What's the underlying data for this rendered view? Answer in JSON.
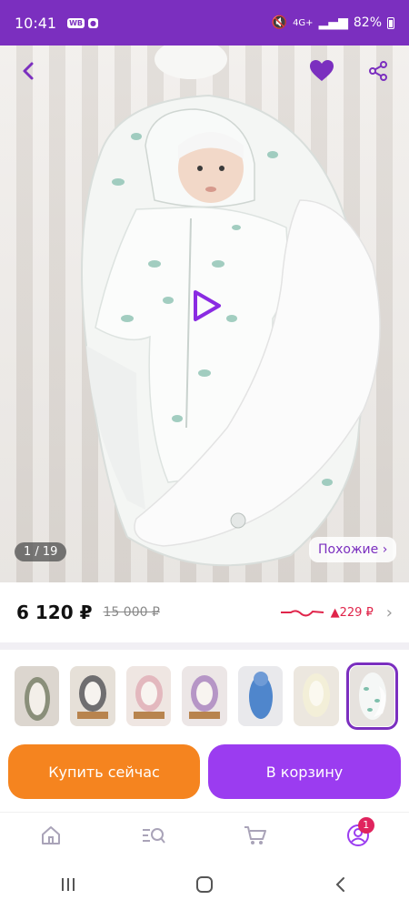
{
  "status_bar": {
    "time": "10:41",
    "badges": [
      "WB",
      "●"
    ],
    "network": "4G+",
    "battery": "82%"
  },
  "hero": {
    "image_counter": "1 / 19",
    "similar_label": "Похожие ›",
    "favorite_color": "#7b2fbf"
  },
  "price": {
    "current": "6 120 ₽",
    "old": "15 000 ₽",
    "trend_delta": "▲229 ₽",
    "trend_color": "#e0244a"
  },
  "thumbnails": {
    "count": 7,
    "active_index": 6
  },
  "actions": {
    "buy_label": "Купить сейчас",
    "cart_label": "В корзину"
  },
  "bottom_nav": {
    "items": [
      "home-icon",
      "catalog-search-icon",
      "cart-icon",
      "profile-icon"
    ],
    "profile_badge": "1"
  },
  "colors": {
    "accent": "#7b2fbf",
    "buy": "#f5841f",
    "cart": "#9b3cf0"
  }
}
